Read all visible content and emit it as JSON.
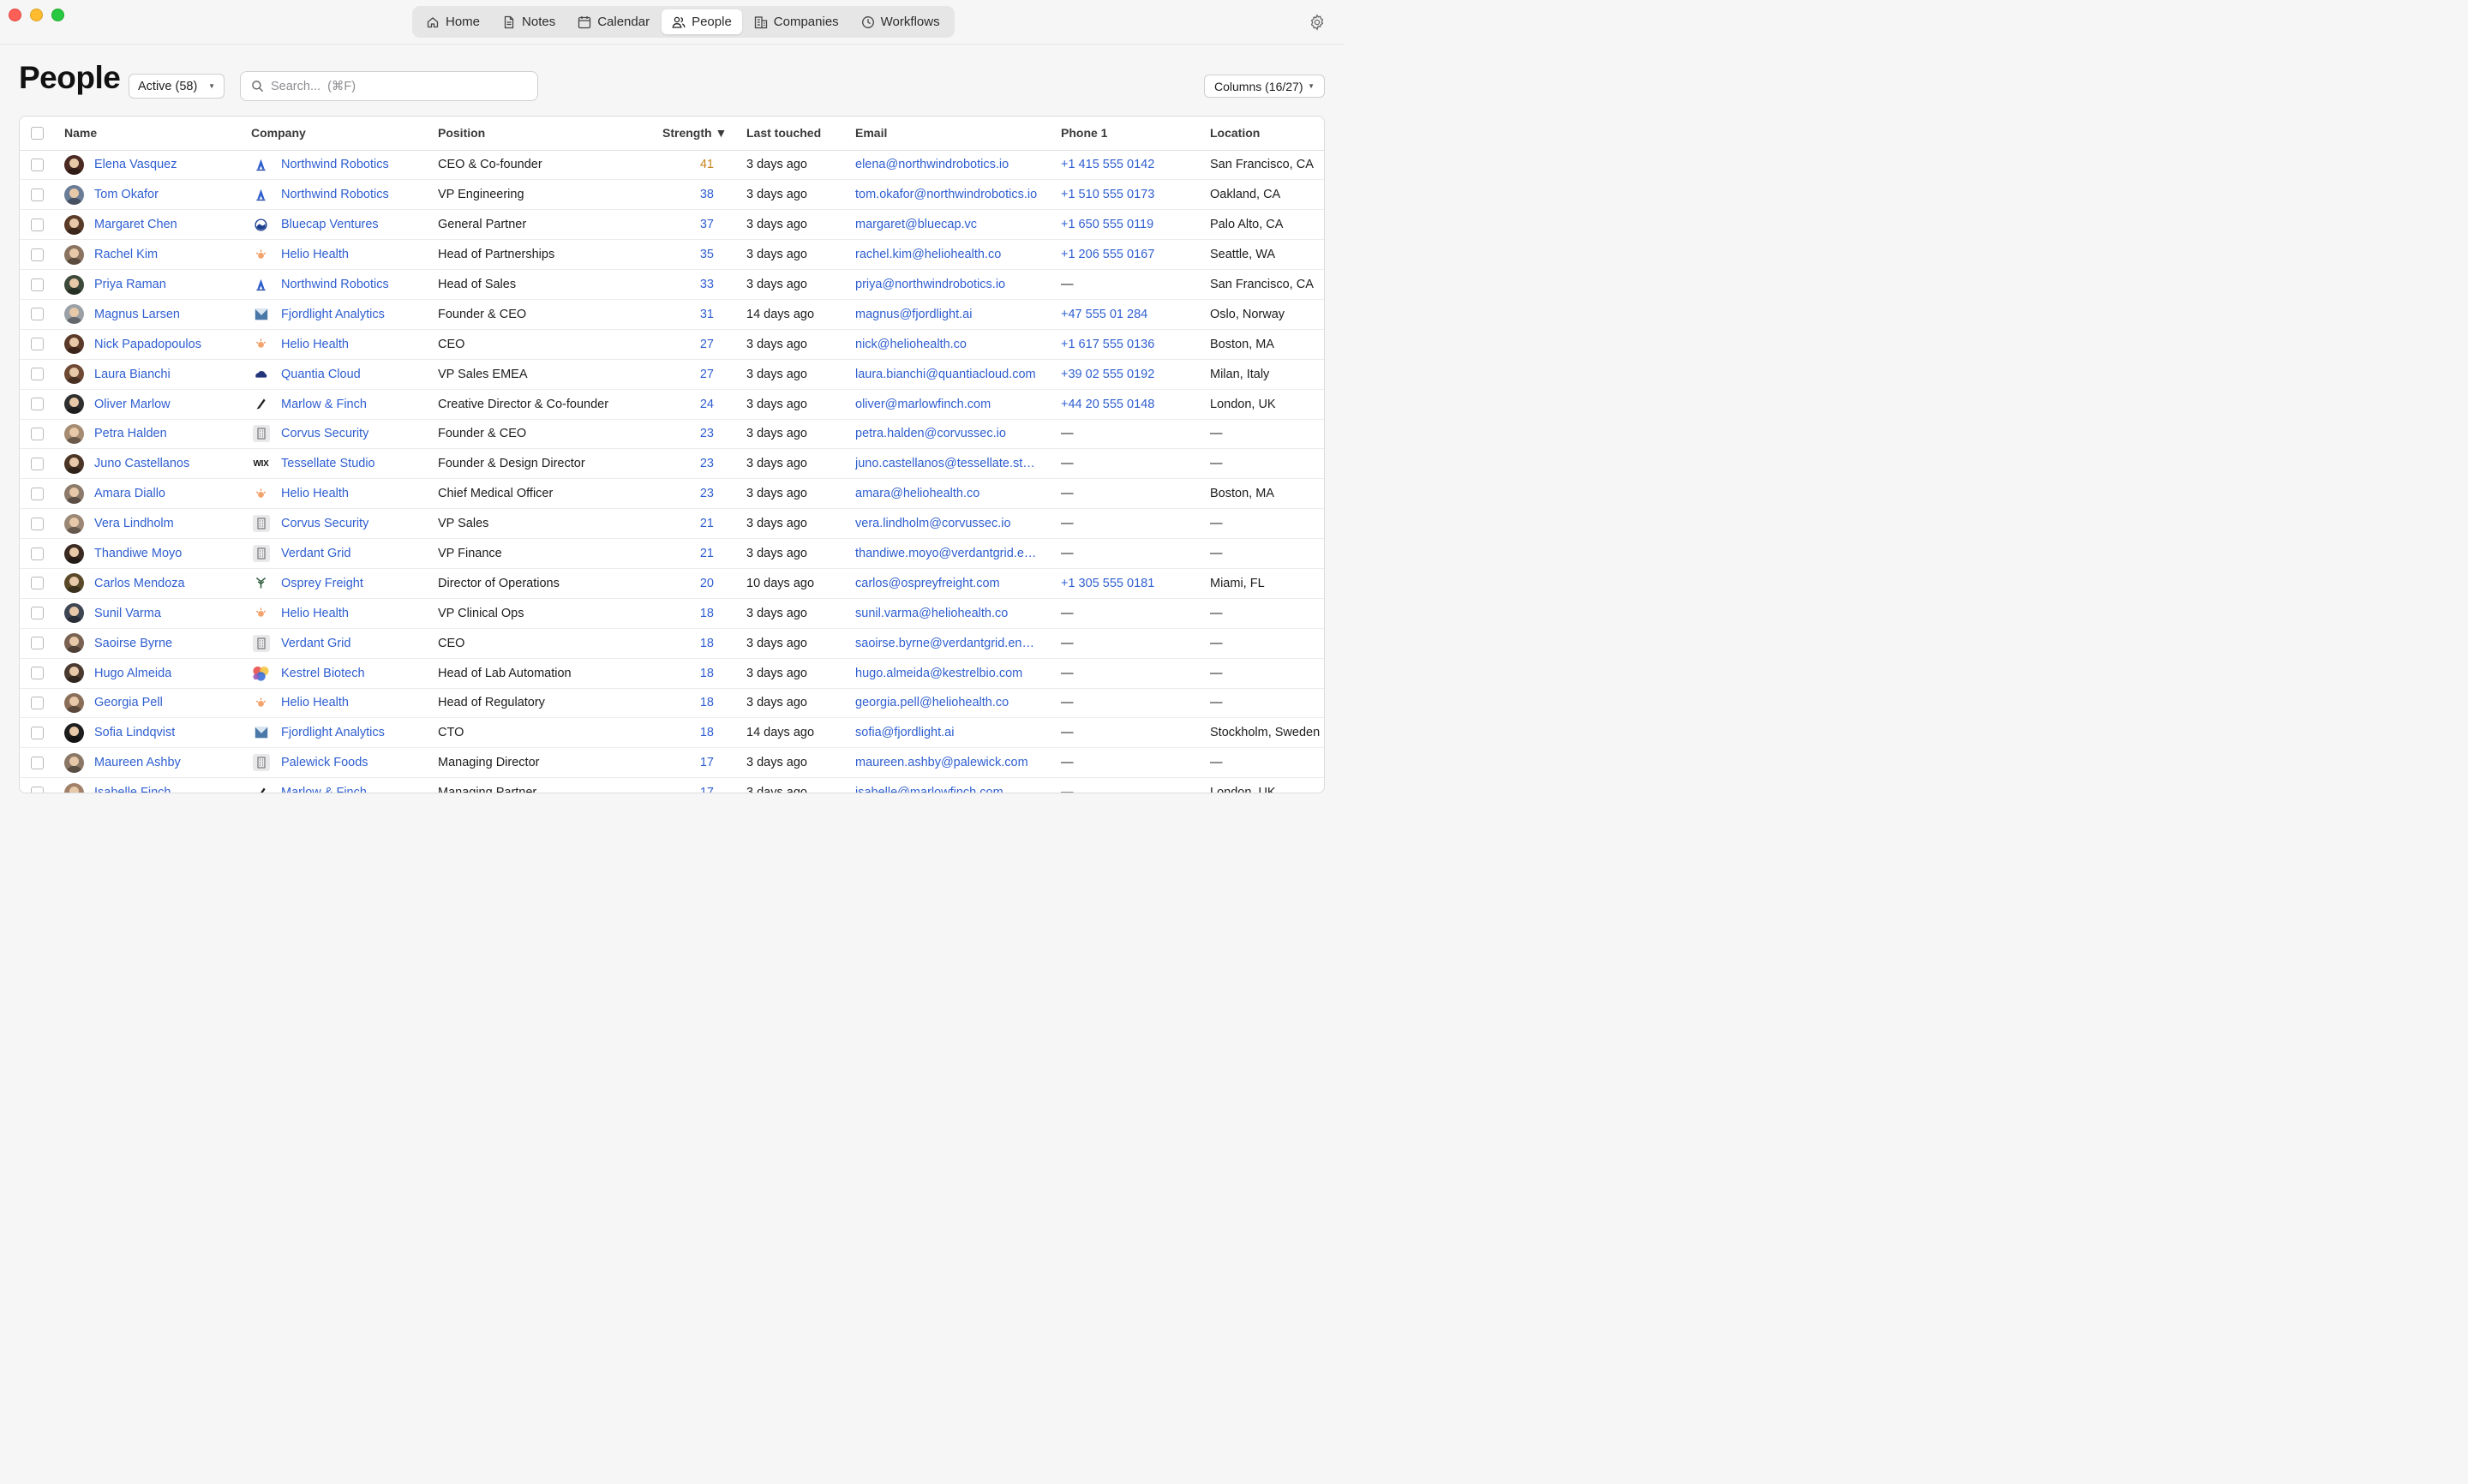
{
  "nav": {
    "items": [
      {
        "label": "Home",
        "icon": "home-icon"
      },
      {
        "label": "Notes",
        "icon": "notes-icon"
      },
      {
        "label": "Calendar",
        "icon": "calendar-icon"
      },
      {
        "label": "People",
        "icon": "people-icon",
        "active": true
      },
      {
        "label": "Companies",
        "icon": "companies-icon"
      },
      {
        "label": "Workflows",
        "icon": "workflows-icon"
      }
    ]
  },
  "header": {
    "title": "People",
    "filter": "Active (58)",
    "search_placeholder": "Search...  (⌘F)",
    "columns": "Columns (16/27)"
  },
  "table": {
    "headers": {
      "name": "Name",
      "company": "Company",
      "position": "Position",
      "strength": "Strength ▼",
      "last": "Last touched",
      "email": "Email",
      "phone": "Phone 1",
      "location": "Location"
    },
    "rows": [
      {
        "name": "Elena Vasquez",
        "av": "#4a2a22",
        "company": "Northwind Robotics",
        "logo": "northwind",
        "position": "CEO & Co-founder",
        "strength": "41",
        "high": true,
        "last": "3 days ago",
        "email": "elena@northwindrobotics.io",
        "phone": "+1 415 555 0142",
        "location": "San Francisco, CA"
      },
      {
        "name": "Tom Okafor",
        "av": "#6b7d96",
        "company": "Northwind Robotics",
        "logo": "northwind",
        "position": "VP Engineering",
        "strength": "38",
        "last": "3 days ago",
        "email": "tom.okafor@northwindrobotics.io",
        "phone": "+1 510 555 0173",
        "location": "Oakland, CA"
      },
      {
        "name": "Margaret Chen",
        "av": "#5a3b28",
        "company": "Bluecap Ventures",
        "logo": "bluecap",
        "position": "General Partner",
        "strength": "37",
        "last": "3 days ago",
        "email": "margaret@bluecap.vc",
        "phone": "+1 650 555 0119",
        "location": "Palo Alto, CA"
      },
      {
        "name": "Rachel Kim",
        "av": "#8a7360",
        "company": "Helio Health",
        "logo": "helio",
        "position": "Head of Partnerships",
        "strength": "35",
        "last": "3 days ago",
        "email": "rachel.kim@heliohealth.co",
        "phone": "+1 206 555 0167",
        "location": "Seattle, WA"
      },
      {
        "name": "Priya Raman",
        "av": "#3d4a3a",
        "company": "Northwind Robotics",
        "logo": "northwind",
        "position": "Head of Sales",
        "strength": "33",
        "last": "3 days ago",
        "email": "priya@northwindrobotics.io",
        "phone": "—",
        "location": "San Francisco, CA"
      },
      {
        "name": "Magnus Larsen",
        "av": "#9aa0a6",
        "company": "Fjordlight Analytics",
        "logo": "fjord",
        "position": "Founder & CEO",
        "strength": "31",
        "last": "14 days ago",
        "email": "magnus@fjordlight.ai",
        "phone": "+47 555 01 284",
        "location": "Oslo, Norway"
      },
      {
        "name": "Nick Papadopoulos",
        "av": "#5b3a2a",
        "company": "Helio Health",
        "logo": "helio",
        "position": "CEO",
        "strength": "27",
        "last": "3 days ago",
        "email": "nick@heliohealth.co",
        "phone": "+1 617 555 0136",
        "location": "Boston, MA"
      },
      {
        "name": "Laura Bianchi",
        "av": "#6e4a34",
        "company": "Quantia Cloud",
        "logo": "quantia",
        "position": "VP Sales EMEA",
        "strength": "27",
        "last": "3 days ago",
        "email": "laura.bianchi@quantiacloud.com",
        "phone": "+39 02 555 0192",
        "location": "Milan, Italy"
      },
      {
        "name": "Oliver Marlow",
        "av": "#2f2f2f",
        "company": "Marlow & Finch",
        "logo": "marlow",
        "position": "Creative Director & Co-founder",
        "strength": "24",
        "last": "3 days ago",
        "email": "oliver@marlowfinch.com",
        "phone": "+44 20 555 0148",
        "location": "London, UK"
      },
      {
        "name": "Petra Halden",
        "av": "#a58b72",
        "company": "Corvus Security",
        "logo": "building",
        "position": "Founder & CEO",
        "strength": "23",
        "last": "3 days ago",
        "email": "petra.halden@corvussec.io",
        "phone": "—",
        "location": "—"
      },
      {
        "name": "Juno Castellanos",
        "av": "#4b3526",
        "company": "Tessellate Studio",
        "logo": "wix",
        "position": "Founder & Design Director",
        "strength": "23",
        "last": "3 days ago",
        "email": "juno.castellanos@tessellate.studio",
        "phone": "—",
        "location": "—"
      },
      {
        "name": "Amara Diallo",
        "av": "#8c7a6a",
        "company": "Helio Health",
        "logo": "helio",
        "position": "Chief Medical Officer",
        "strength": "23",
        "last": "3 days ago",
        "email": "amara@heliohealth.co",
        "phone": "—",
        "location": "Boston, MA"
      },
      {
        "name": "Vera Lindholm",
        "av": "#9b8775",
        "company": "Corvus Security",
        "logo": "building",
        "position": "VP Sales",
        "strength": "21",
        "last": "3 days ago",
        "email": "vera.lindholm@corvussec.io",
        "phone": "—",
        "location": "—"
      },
      {
        "name": "Thandiwe Moyo",
        "av": "#3a2a22",
        "company": "Verdant Grid",
        "logo": "building",
        "position": "VP Finance",
        "strength": "21",
        "last": "3 days ago",
        "email": "thandiwe.moyo@verdantgrid.energy",
        "phone": "—",
        "location": "—"
      },
      {
        "name": "Carlos Mendoza",
        "av": "#5a4a2a",
        "company": "Osprey Freight",
        "logo": "osprey",
        "position": "Director of Operations",
        "strength": "20",
        "last": "10 days ago",
        "email": "carlos@ospreyfreight.com",
        "phone": "+1 305 555 0181",
        "location": "Miami, FL"
      },
      {
        "name": "Sunil Varma",
        "av": "#3e4654",
        "company": "Helio Health",
        "logo": "helio",
        "position": "VP Clinical Ops",
        "strength": "18",
        "last": "3 days ago",
        "email": "sunil.varma@heliohealth.co",
        "phone": "—",
        "location": "—"
      },
      {
        "name": "Saoirse Byrne",
        "av": "#7a6252",
        "company": "Verdant Grid",
        "logo": "building",
        "position": "CEO",
        "strength": "18",
        "last": "3 days ago",
        "email": "saoirse.byrne@verdantgrid.energy",
        "phone": "—",
        "location": "—"
      },
      {
        "name": "Hugo Almeida",
        "av": "#4a3a30",
        "company": "Kestrel Biotech",
        "logo": "kestrel",
        "position": "Head of Lab Automation",
        "strength": "18",
        "last": "3 days ago",
        "email": "hugo.almeida@kestrelbio.com",
        "phone": "—",
        "location": "—"
      },
      {
        "name": "Georgia Pell",
        "av": "#8a6e58",
        "company": "Helio Health",
        "logo": "helio",
        "position": "Head of Regulatory",
        "strength": "18",
        "last": "3 days ago",
        "email": "georgia.pell@heliohealth.co",
        "phone": "—",
        "location": "—"
      },
      {
        "name": "Sofia Lindqvist",
        "av": "#1e1e1e",
        "company": "Fjordlight Analytics",
        "logo": "fjord",
        "position": "CTO",
        "strength": "18",
        "last": "14 days ago",
        "email": "sofia@fjordlight.ai",
        "phone": "—",
        "location": "Stockholm, Sweden"
      },
      {
        "name": "Maureen Ashby",
        "av": "#8b7766",
        "company": "Palewick Foods",
        "logo": "building",
        "position": "Managing Director",
        "strength": "17",
        "last": "3 days ago",
        "email": "maureen.ashby@palewick.com",
        "phone": "—",
        "location": "—"
      },
      {
        "name": "Isabelle Finch",
        "av": "#a08068",
        "company": "Marlow & Finch",
        "logo": "marlow",
        "position": "Managing Partner",
        "strength": "17",
        "last": "3 days ago",
        "email": "isabelle@marlowfinch.com",
        "phone": "—",
        "location": "London, UK"
      }
    ]
  }
}
